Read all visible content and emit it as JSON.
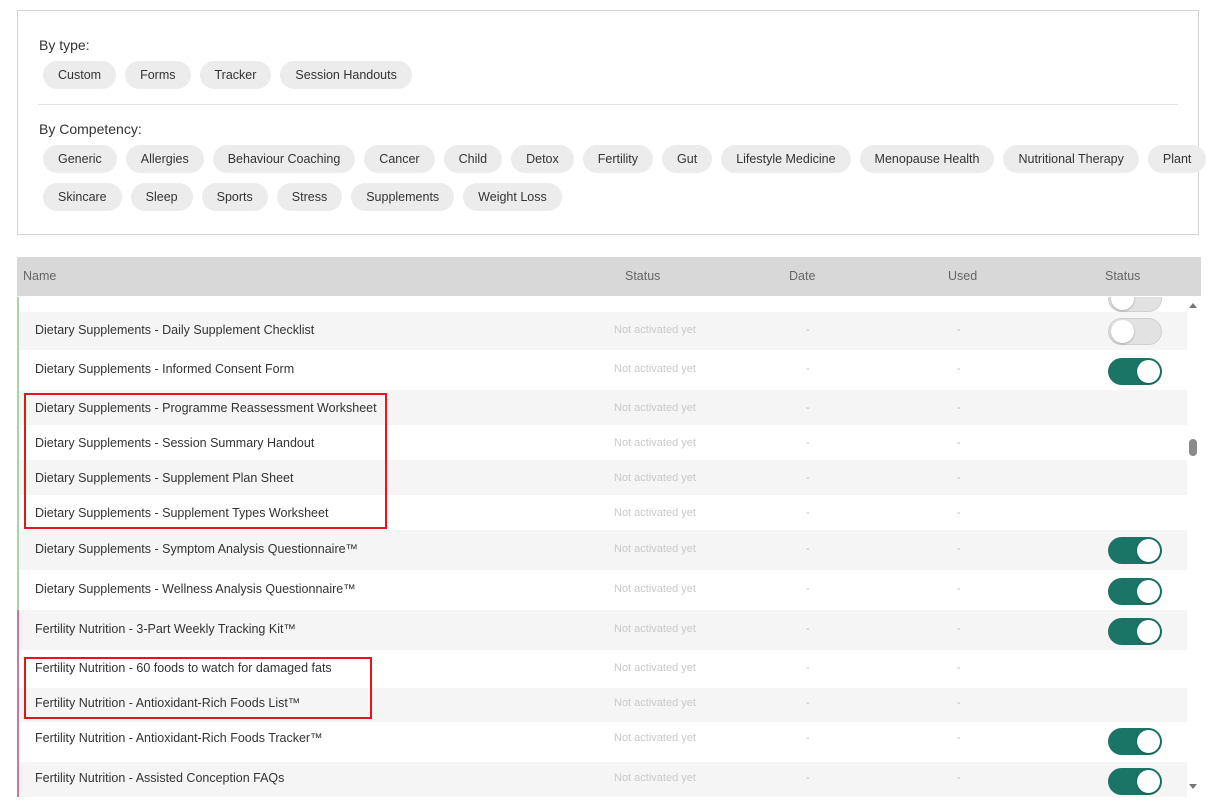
{
  "filters": {
    "by_type_label": "By type:",
    "type_chips": [
      "Custom",
      "Forms",
      "Tracker",
      "Session Handouts"
    ],
    "by_competency_label": "By Competency:",
    "competency_row1": [
      "Generic",
      "Allergies",
      "Behaviour Coaching",
      "Cancer",
      "Child",
      "Detox",
      "Fertility",
      "Gut",
      "Lifestyle Medicine",
      "Menopause Health",
      "Nutritional Therapy",
      "Plant"
    ],
    "competency_row2": [
      "Skincare",
      "Sleep",
      "Sports",
      "Stress",
      "Supplements",
      "Weight Loss"
    ]
  },
  "table": {
    "headers": {
      "name": "Name",
      "status": "Status",
      "date": "Date",
      "used": "Used",
      "toggle_status": "Status"
    },
    "rows": [
      {
        "name": "Dietary Supplements - Daily Supplement Checklist",
        "status": "Not activated yet",
        "date": "-",
        "used": "-",
        "toggle": "off",
        "group": "supplements"
      },
      {
        "name": "Dietary Supplements - Informed Consent Form",
        "status": "Not activated yet",
        "date": "-",
        "used": "-",
        "toggle": "on",
        "group": "supplements"
      },
      {
        "name": "Dietary Supplements - Programme Reassessment Worksheet",
        "status": "Not activated yet",
        "date": "-",
        "used": "-",
        "toggle": "none",
        "group": "supplements"
      },
      {
        "name": "Dietary Supplements - Session Summary Handout",
        "status": "Not activated yet",
        "date": "-",
        "used": "-",
        "toggle": "none",
        "group": "supplements"
      },
      {
        "name": "Dietary Supplements - Supplement Plan Sheet",
        "status": "Not activated yet",
        "date": "-",
        "used": "-",
        "toggle": "none",
        "group": "supplements"
      },
      {
        "name": "Dietary Supplements - Supplement Types Worksheet",
        "status": "Not activated yet",
        "date": "-",
        "used": "-",
        "toggle": "none",
        "group": "supplements"
      },
      {
        "name": "Dietary Supplements - Symptom Analysis Questionnaire™",
        "status": "Not activated yet",
        "date": "-",
        "used": "-",
        "toggle": "on",
        "group": "supplements"
      },
      {
        "name": "Dietary Supplements - Wellness Analysis Questionnaire™",
        "status": "Not activated yet",
        "date": "-",
        "used": "-",
        "toggle": "on",
        "group": "supplements"
      },
      {
        "name": "Fertility Nutrition - 3-Part Weekly Tracking Kit™",
        "status": "Not activated yet",
        "date": "-",
        "used": "-",
        "toggle": "on",
        "group": "fertility"
      },
      {
        "name": "Fertility Nutrition - 60 foods to watch for damaged fats",
        "status": "Not activated yet",
        "date": "-",
        "used": "-",
        "toggle": "none",
        "group": "fertility"
      },
      {
        "name": "Fertility Nutrition - Antioxidant-Rich Foods List™",
        "status": "Not activated yet",
        "date": "-",
        "used": "-",
        "toggle": "none",
        "group": "fertility"
      },
      {
        "name": "Fertility Nutrition - Antioxidant-Rich Foods Tracker™",
        "status": "Not activated yet",
        "date": "-",
        "used": "-",
        "toggle": "on",
        "group": "fertility"
      },
      {
        "name": "Fertility Nutrition - Assisted Conception FAQs",
        "status": "Not activated yet",
        "date": "-",
        "used": "-",
        "toggle": "on",
        "group": "fertility"
      }
    ]
  },
  "colors": {
    "toggle_on": "#1b7566",
    "supplements_accent": "#a8d5a8",
    "fertility_accent": "#c8789a",
    "highlight": "#e0181d"
  }
}
